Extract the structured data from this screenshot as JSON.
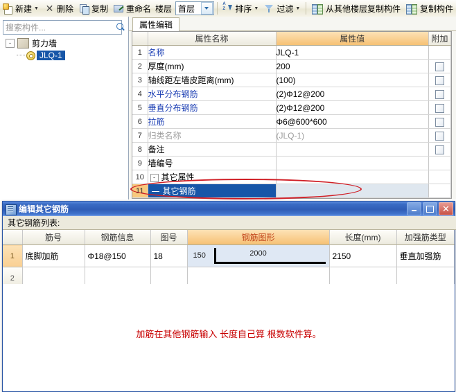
{
  "toolbar": {
    "items": [
      {
        "id": "new",
        "label": "新建",
        "icon": "new-icon",
        "dropdown": true
      },
      {
        "id": "delete",
        "label": "删除",
        "icon": "delete-x-icon",
        "dropdown": false
      },
      {
        "id": "copy",
        "label": "复制",
        "icon": "copy-icon",
        "dropdown": false
      },
      {
        "id": "rename",
        "label": "重命名",
        "icon": "rename-icon",
        "dropdown": false
      }
    ],
    "floor_label": "楼层",
    "floor_value": "首层",
    "sort_label": "排序",
    "filter_label": "过滤",
    "copy_from_other_floor_label": "从其他楼层复制构件",
    "copy_component_label": "复制构件"
  },
  "sidebar": {
    "search_placeholder": "搜索构件...",
    "search_value": "",
    "tree": {
      "root_label": "剪力墙",
      "expander": "-",
      "child_label": "JLQ-1"
    }
  },
  "property_panel": {
    "tab_label": "属性编辑",
    "headers": [
      "",
      "属性名称",
      "属性值",
      "附加"
    ],
    "rows": [
      {
        "no": "1",
        "name": "名称",
        "value": "JLQ-1",
        "style": "blue",
        "checkbox": false,
        "indent": 1
      },
      {
        "no": "2",
        "name": "厚度(mm)",
        "value": "200",
        "style": "black",
        "checkbox": true,
        "indent": 1
      },
      {
        "no": "3",
        "name": "轴线距左墙皮距离(mm)",
        "value": "(100)",
        "style": "black",
        "checkbox": true,
        "indent": 1
      },
      {
        "no": "4",
        "name": "水平分布钢筋",
        "value": "(2)Φ12@200",
        "style": "blue",
        "checkbox": true,
        "indent": 1
      },
      {
        "no": "5",
        "name": "垂直分布钢筋",
        "value": "(2)Φ12@200",
        "style": "blue",
        "checkbox": true,
        "indent": 1
      },
      {
        "no": "6",
        "name": "拉筋",
        "value": "Φ6@600*600",
        "style": "blue",
        "checkbox": true,
        "indent": 1
      },
      {
        "no": "7",
        "name": "归类名称",
        "value": "(JLQ-1)",
        "style": "gray",
        "checkbox": true,
        "indent": 1
      },
      {
        "no": "8",
        "name": "备注",
        "value": "",
        "style": "black",
        "checkbox": true,
        "indent": 1
      },
      {
        "no": "9",
        "name": "墙编号",
        "value": "",
        "style": "black",
        "checkbox": false,
        "indent": 1
      },
      {
        "no": "10",
        "name": "其它属性",
        "value": "",
        "style": "group",
        "checkbox": false,
        "indent": 0
      },
      {
        "no": "11",
        "name": "其它钢筋",
        "value": "",
        "style": "selected",
        "checkbox": false,
        "indent": 2
      }
    ]
  },
  "dialog": {
    "title": "编辑其它钢筋",
    "window_buttons": {
      "minimize": "minimize-button",
      "maximize": "maximize-button",
      "close": "close-button"
    },
    "list_label": "其它钢筋列表:",
    "headers": [
      "",
      "筋号",
      "钢筋信息",
      "图号",
      "钢筋图形",
      "长度(mm)",
      "加强筋类型"
    ],
    "rows": [
      {
        "no": "1",
        "bar_name": "底脚加筋",
        "bar_info": "Φ18@150",
        "fig_no": "18",
        "shape": {
          "leg": "150",
          "run": "2000"
        },
        "length": "2150",
        "type": "垂直加强筋"
      },
      {
        "no": "2",
        "bar_name": "",
        "bar_info": "",
        "fig_no": "",
        "shape": {
          "leg": "",
          "run": ""
        },
        "length": "",
        "type": ""
      }
    ],
    "note": "加筋在其他钢筋输入  长度自己算  根数软件算。"
  },
  "colors": {
    "accent_header": "#f6c174",
    "selection": "#1756a8",
    "note_red": "#c80000",
    "annotation_red": "#d01f26"
  }
}
